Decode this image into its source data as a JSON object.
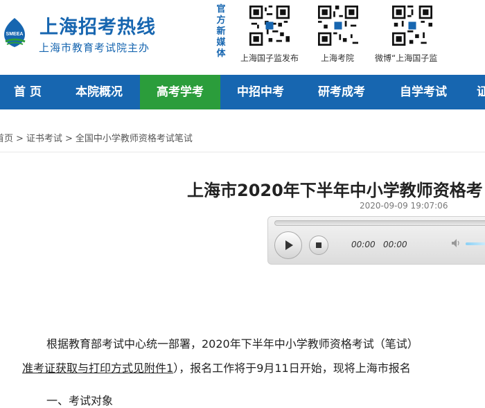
{
  "header": {
    "site_title": "上海招考热线",
    "site_subtitle": "上海市教育考试院主办",
    "logo_text": "SMEEA",
    "media_label": "官方新媒体",
    "qr_codes": [
      {
        "caption": "上海国子监发布"
      },
      {
        "caption": "上海考院"
      },
      {
        "caption": "微博“上海国子监"
      }
    ]
  },
  "nav": {
    "items": [
      {
        "label": "首 页"
      },
      {
        "label": "本院概况"
      },
      {
        "label": "高考学考",
        "active": true
      },
      {
        "label": "中招中考"
      },
      {
        "label": "研考成考"
      },
      {
        "label": "自学考试"
      },
      {
        "label": "证"
      }
    ],
    "active_color": "#2b9d3b",
    "bar_color": "#1766b0"
  },
  "breadcrumb": {
    "items": [
      "首页",
      "证书考试",
      "全国中小学教师资格考试笔试"
    ],
    "separator": ">"
  },
  "article": {
    "title": "上海市2020年下半年中小学教师资格考",
    "date": "2020-09-09 19:07:06",
    "player": {
      "current_time": "00:00",
      "duration": "00:00"
    },
    "para1": "根据教育部考试中心统一部署，2020年下半年中小学教师资格考试（笔试）",
    "para2_link": "准考证获取与打印方式见附件1",
    "para2_rest": "），报名工作将于9月11日开始，现将上海市报名",
    "section1": "一、考试对象"
  }
}
